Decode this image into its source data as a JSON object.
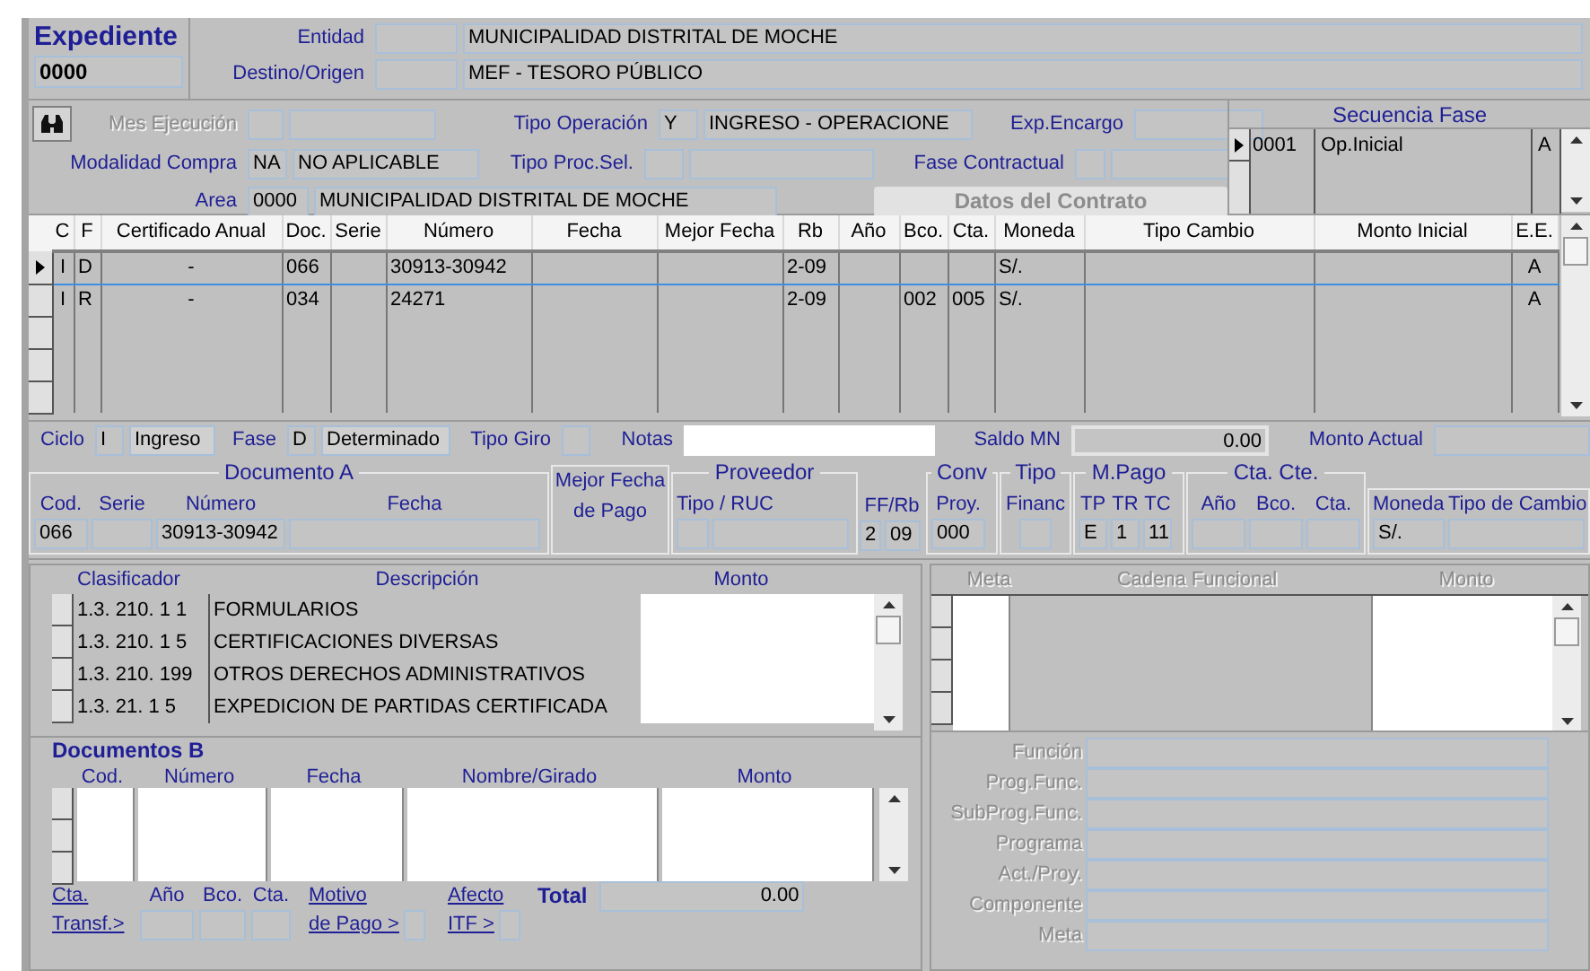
{
  "expediente": {
    "title": "Expediente",
    "number": "0000"
  },
  "entidad": {
    "label": "Entidad",
    "name": "MUNICIPALIDAD DISTRITAL DE MOCHE"
  },
  "destino_origen": {
    "label": "Destino/Origen",
    "name": "MEF - TESORO PÚBLICO"
  },
  "mes_ejecucion": {
    "label": "Mes Ejecución",
    "disabled": true
  },
  "tipo_operacion": {
    "label": "Tipo Operación",
    "code": "Y",
    "name": "INGRESO - OPERACIONE"
  },
  "exp_encargo": {
    "label": "Exp.Encargo"
  },
  "modalidad_compra": {
    "label": "Modalidad Compra",
    "code": "NA",
    "name": "NO APLICABLE"
  },
  "tipo_proc_sel": {
    "label": "Tipo Proc.Sel."
  },
  "fase_contractual": {
    "label": "Fase Contractual"
  },
  "area": {
    "label": "Area",
    "code": "0000",
    "name": "MUNICIPALIDAD DISTRITAL DE MOCHE"
  },
  "contract_button": {
    "label": "Datos del Contrato",
    "disabled": true
  },
  "secuencia_fase": {
    "title": "Secuencia Fase",
    "rows": [
      {
        "code": "0001",
        "name": "Op.Inicial",
        "estado": "A",
        "selected": true
      }
    ]
  },
  "main_table": {
    "columns": [
      "C",
      "F",
      "Certificado Anual",
      "Doc.",
      "Serie",
      "Número",
      "Fecha",
      "Mejor Fecha",
      "Rb",
      "Año",
      "Bco.",
      "Cta.",
      "Moneda",
      "Tipo Cambio",
      "Monto Inicial",
      "E.E."
    ],
    "rows": [
      {
        "selected": true,
        "cells": [
          "I",
          "D",
          "-",
          "066",
          null,
          "30913-30942",
          null,
          null,
          "2-09",
          null,
          null,
          null,
          "S/.",
          null,
          null,
          "A"
        ]
      },
      {
        "selected": false,
        "cells": [
          "I",
          "R",
          "-",
          "034",
          null,
          "24271",
          null,
          null,
          "2-09",
          null,
          "002",
          "005",
          "S/.",
          null,
          null,
          "A"
        ]
      }
    ]
  },
  "ciclo": {
    "label": "Ciclo",
    "code": "I",
    "name": "Ingreso"
  },
  "fase": {
    "label": "Fase",
    "code": "D",
    "name": "Determinado"
  },
  "tipo_giro": {
    "label": "Tipo Giro"
  },
  "notas": {
    "label": "Notas"
  },
  "saldo_mn": {
    "label": "Saldo MN",
    "value": "0.00"
  },
  "monto_actual": {
    "label": "Monto Actual"
  },
  "documento_a": {
    "title": "Documento A",
    "fields": [
      {
        "column": "Cod.",
        "value": "066"
      },
      {
        "column": "Serie"
      },
      {
        "column": "Número",
        "value": "30913-30942"
      },
      {
        "column": "Fecha"
      }
    ]
  },
  "mejor_fecha_pago": {
    "title": "Mejor Fecha",
    "subtitle": "de Pago"
  },
  "proveedor": {
    "title": "Proveedor",
    "column": "Tipo / RUC"
  },
  "ff_rb": {
    "column": "FF/Rb",
    "values": [
      "2",
      "09"
    ]
  },
  "conv": {
    "title": "Conv",
    "column": "Proy.",
    "value": "000"
  },
  "tipo": {
    "title": "Tipo",
    "column": "Financ"
  },
  "m_pago": {
    "title": "M.Pago",
    "columns": [
      "TP",
      "TR",
      "TC"
    ],
    "values": [
      "E",
      "1",
      "11"
    ]
  },
  "cta_cte": {
    "title": "Cta. Cte.",
    "columns": [
      "Año",
      "Bco.",
      "Cta."
    ]
  },
  "moneda": {
    "columns": [
      "Moneda",
      "Tipo de Cambio"
    ],
    "value": "S/."
  },
  "clasificadores": {
    "columns": [
      "Clasificador",
      "Descripción",
      "Monto"
    ],
    "rows": [
      {
        "code": "1.3. 210. 1 1",
        "description": "FORMULARIOS"
      },
      {
        "code": "1.3. 210. 1 5",
        "description": "CERTIFICACIONES DIVERSAS"
      },
      {
        "code": "1.3. 210. 199",
        "description": "OTROS DERECHOS ADMINISTRATIVOS"
      },
      {
        "code": "1.3. 21. 1 5",
        "description": "EXPEDICION DE PARTIDAS CERTIFICADA"
      }
    ]
  },
  "documentos_b": {
    "title": "Documentos B",
    "columns": [
      "Cod.",
      "Número",
      "Fecha",
      "Nombre/Girado",
      "Monto"
    ],
    "cta_transf": [
      "Cta.",
      "Transf.>"
    ],
    "cta_columns": [
      "Año",
      "Bco.",
      "Cta."
    ],
    "motivo_pago": [
      "Motivo",
      "de Pago >"
    ],
    "afecto_itf": [
      "Afecto",
      "ITF >"
    ],
    "total": {
      "label": "Total",
      "value": "0.00"
    }
  },
  "presupuesto": {
    "disabled": true,
    "columns": [
      "Meta",
      "Cadena Funcional",
      "Monto"
    ],
    "fields": [
      "Función",
      "Prog.Func.",
      "SubProg.Func.",
      "Programa",
      "Act./Proy.",
      "Componente",
      "Meta"
    ]
  }
}
